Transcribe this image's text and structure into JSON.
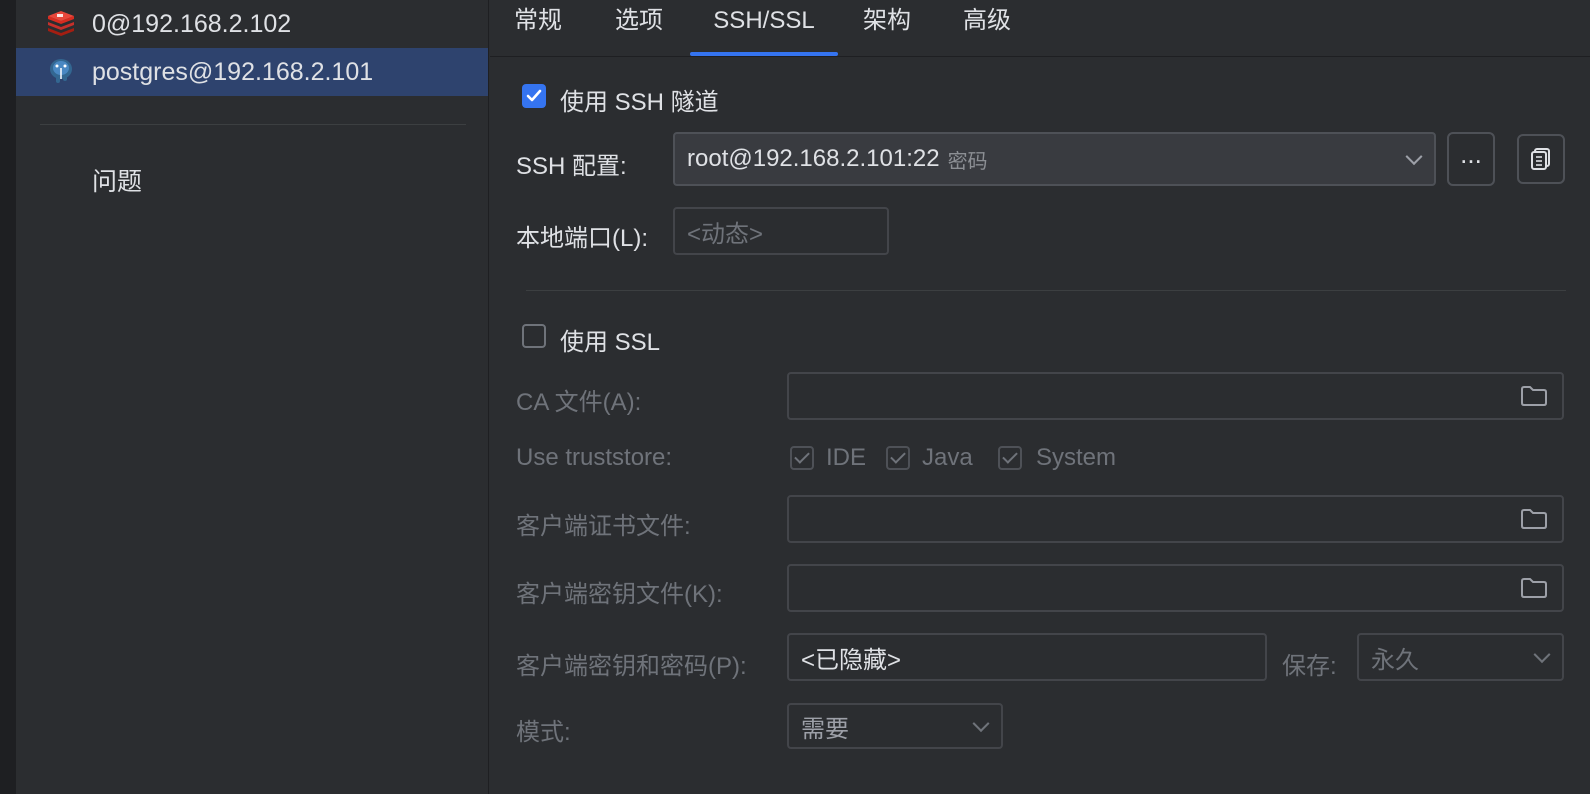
{
  "sidebar": {
    "connections": [
      {
        "label": "0@192.168.2.102",
        "icon": "redis-icon",
        "selected": false
      },
      {
        "label": "postgres@192.168.2.101",
        "icon": "postgresql-icon",
        "selected": true
      }
    ],
    "problems_label": "问题"
  },
  "tabs": [
    {
      "label": "常规"
    },
    {
      "label": "选项"
    },
    {
      "label": "SSH/SSL",
      "active": true
    },
    {
      "label": "架构"
    },
    {
      "label": "高级"
    }
  ],
  "ssh": {
    "use_tunnel_label": "使用 SSH 隧道",
    "use_tunnel_checked": true,
    "config_label": "SSH 配置:",
    "config_value": "root@192.168.2.101:22",
    "config_auth": "密码",
    "more_button_label": "...",
    "local_port_label": "本地端口(L):",
    "local_port_placeholder": "<动态>"
  },
  "ssl": {
    "use_ssl_label": "使用 SSL",
    "use_ssl_checked": false,
    "ca_file_label": "CA 文件(A):",
    "truststore_label": "Use truststore:",
    "truststore_options": [
      "IDE",
      "Java",
      "System"
    ],
    "client_cert_label": "客户端证书文件:",
    "client_key_label": "客户端密钥文件(K):",
    "key_password_label": "客户端密钥和密码(P):",
    "key_password_value": "<已隐藏>",
    "save_label": "保存:",
    "save_value": "永久",
    "mode_label": "模式:",
    "mode_value": "需要"
  },
  "colors": {
    "accent": "#3574f0",
    "selection": "#2e436e",
    "redis": "#d82c20",
    "postgres": "#336791"
  }
}
